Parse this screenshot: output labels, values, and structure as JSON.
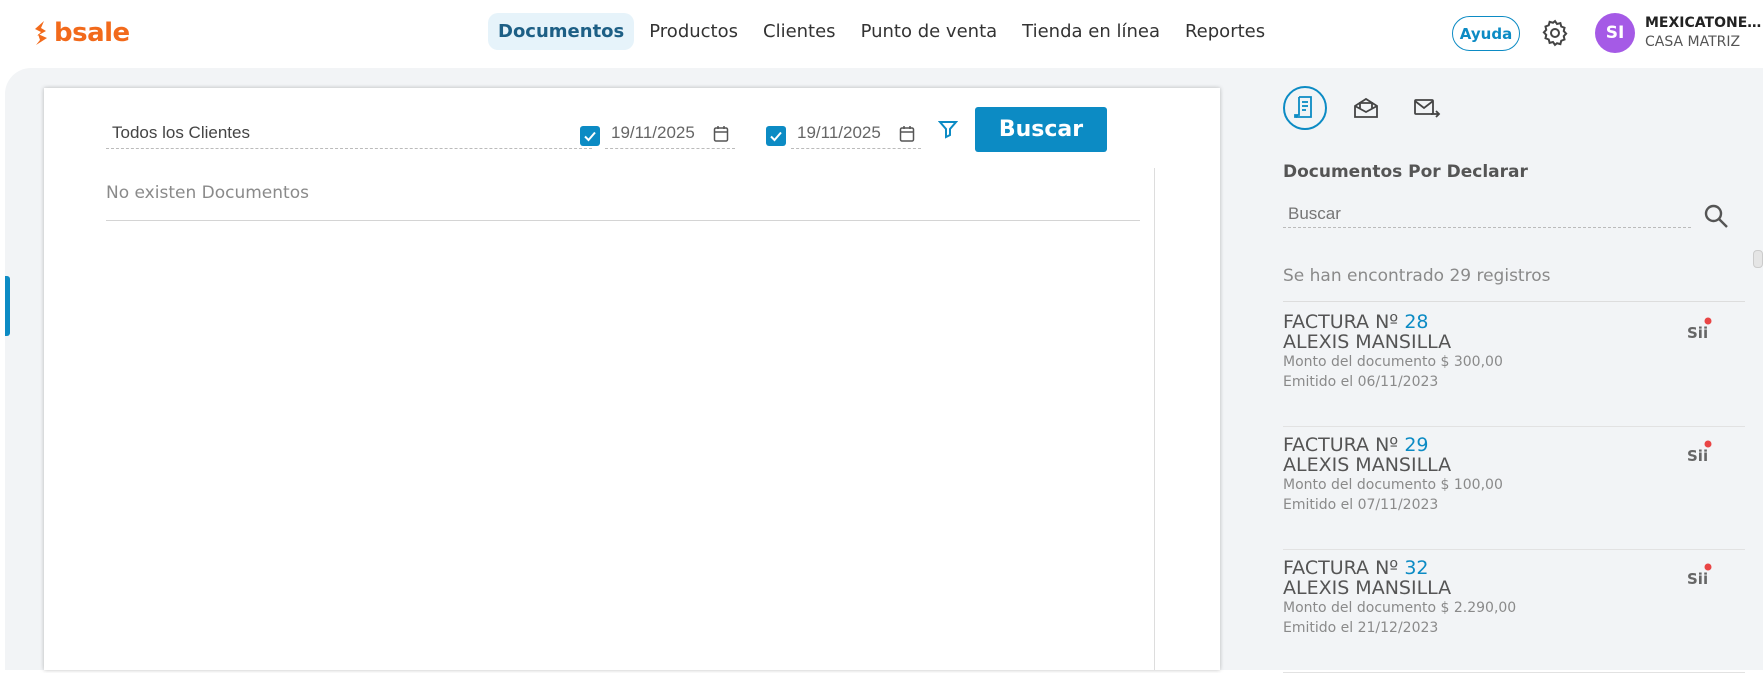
{
  "brand": {
    "logo_text": "bsale",
    "accent": "#f26a1b",
    "primary": "#0c8bc4"
  },
  "nav": {
    "tabs": [
      {
        "label": "Documentos",
        "active": true
      },
      {
        "label": "Productos",
        "active": false
      },
      {
        "label": "Clientes",
        "active": false
      },
      {
        "label": "Punto de venta",
        "active": false
      },
      {
        "label": "Tienda en línea",
        "active": false
      },
      {
        "label": "Reportes",
        "active": false
      }
    ]
  },
  "header": {
    "help_label": "Ayuda",
    "avatar_initials": "SI",
    "company_name": "MEXICATONE...",
    "branch_name": "CASA MATRIZ"
  },
  "filters": {
    "client_value": "Todos los Clientes",
    "date_from": "19/11/2025",
    "date_from_checked": true,
    "date_to": "19/11/2025",
    "date_to_checked": true,
    "search_button_label": "Buscar"
  },
  "results": {
    "empty_text": "No existen Documentos"
  },
  "side": {
    "title": "Documentos Por Declarar",
    "search_placeholder": "Buscar",
    "count_text": "Se han encontrado 29 registros",
    "documents": [
      {
        "type": "FACTURA Nº",
        "number": "28",
        "client": "ALEXIS MANSILLA",
        "amount": "Monto del documento $ 300,00",
        "issued": "Emitido el 06/11/2023"
      },
      {
        "type": "FACTURA Nº",
        "number": "29",
        "client": "ALEXIS MANSILLA",
        "amount": "Monto del documento $ 100,00",
        "issued": "Emitido el 07/11/2023"
      },
      {
        "type": "FACTURA Nº",
        "number": "32",
        "client": "ALEXIS MANSILLA",
        "amount": "Monto del documento $ 2.290,00",
        "issued": "Emitido el 21/12/2023"
      }
    ],
    "sii_label": "Sii"
  }
}
